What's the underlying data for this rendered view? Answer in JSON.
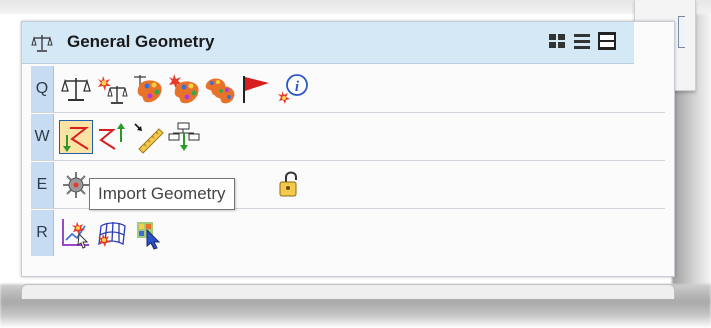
{
  "panel": {
    "title": "General Geometry",
    "title_icon": "balance-scale-icon",
    "view_modes": [
      "grid-view-icon",
      "list-view-icon",
      "detail-view-icon"
    ]
  },
  "rows": [
    {
      "key": "Q",
      "tools": [
        "measure-scale-icon",
        "highlight-scale-icon",
        "analyze-color-icon",
        "analyze-color-alt-icon",
        "palette-icon",
        "flag-icon",
        "info-icon"
      ]
    },
    {
      "key": "W",
      "tools": [
        "import-geometry-icon",
        "export-geometry-icon",
        "ruler-icon",
        "hierarchy-icon"
      ]
    },
    {
      "key": "E",
      "tools": [
        "settings-icon",
        "lock-icon"
      ]
    },
    {
      "key": "R",
      "tools": [
        "graph-icon",
        "mesh-icon",
        "select-cursor-icon"
      ]
    }
  ],
  "tooltip": "Import Geometry"
}
